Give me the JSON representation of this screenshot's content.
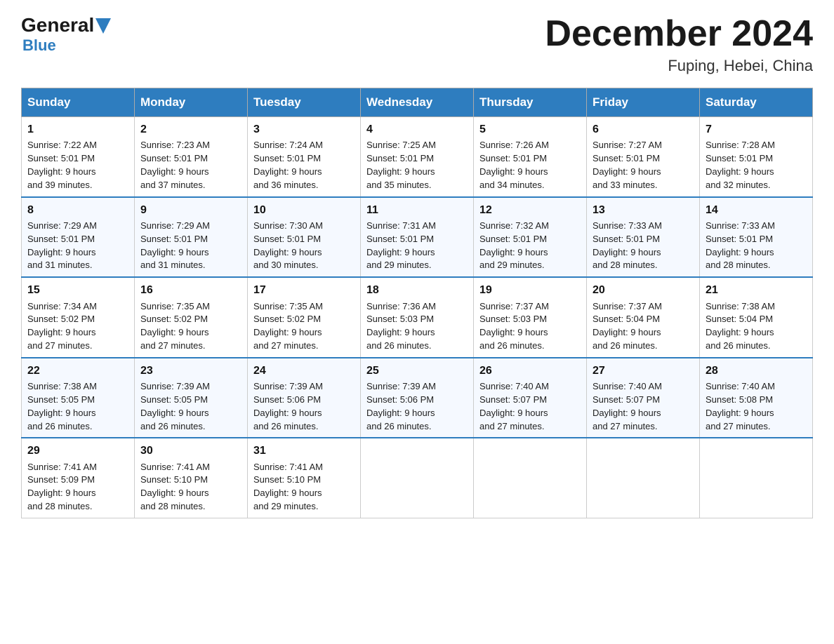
{
  "header": {
    "logo_general": "General",
    "logo_blue": "Blue",
    "month_title": "December 2024",
    "location": "Fuping, Hebei, China"
  },
  "days_of_week": [
    "Sunday",
    "Monday",
    "Tuesday",
    "Wednesday",
    "Thursday",
    "Friday",
    "Saturday"
  ],
  "weeks": [
    [
      {
        "day": "1",
        "sunrise": "7:22 AM",
        "sunset": "5:01 PM",
        "daylight": "9 hours and 39 minutes."
      },
      {
        "day": "2",
        "sunrise": "7:23 AM",
        "sunset": "5:01 PM",
        "daylight": "9 hours and 37 minutes."
      },
      {
        "day": "3",
        "sunrise": "7:24 AM",
        "sunset": "5:01 PM",
        "daylight": "9 hours and 36 minutes."
      },
      {
        "day": "4",
        "sunrise": "7:25 AM",
        "sunset": "5:01 PM",
        "daylight": "9 hours and 35 minutes."
      },
      {
        "day": "5",
        "sunrise": "7:26 AM",
        "sunset": "5:01 PM",
        "daylight": "9 hours and 34 minutes."
      },
      {
        "day": "6",
        "sunrise": "7:27 AM",
        "sunset": "5:01 PM",
        "daylight": "9 hours and 33 minutes."
      },
      {
        "day": "7",
        "sunrise": "7:28 AM",
        "sunset": "5:01 PM",
        "daylight": "9 hours and 32 minutes."
      }
    ],
    [
      {
        "day": "8",
        "sunrise": "7:29 AM",
        "sunset": "5:01 PM",
        "daylight": "9 hours and 31 minutes."
      },
      {
        "day": "9",
        "sunrise": "7:29 AM",
        "sunset": "5:01 PM",
        "daylight": "9 hours and 31 minutes."
      },
      {
        "day": "10",
        "sunrise": "7:30 AM",
        "sunset": "5:01 PM",
        "daylight": "9 hours and 30 minutes."
      },
      {
        "day": "11",
        "sunrise": "7:31 AM",
        "sunset": "5:01 PM",
        "daylight": "9 hours and 29 minutes."
      },
      {
        "day": "12",
        "sunrise": "7:32 AM",
        "sunset": "5:01 PM",
        "daylight": "9 hours and 29 minutes."
      },
      {
        "day": "13",
        "sunrise": "7:33 AM",
        "sunset": "5:01 PM",
        "daylight": "9 hours and 28 minutes."
      },
      {
        "day": "14",
        "sunrise": "7:33 AM",
        "sunset": "5:01 PM",
        "daylight": "9 hours and 28 minutes."
      }
    ],
    [
      {
        "day": "15",
        "sunrise": "7:34 AM",
        "sunset": "5:02 PM",
        "daylight": "9 hours and 27 minutes."
      },
      {
        "day": "16",
        "sunrise": "7:35 AM",
        "sunset": "5:02 PM",
        "daylight": "9 hours and 27 minutes."
      },
      {
        "day": "17",
        "sunrise": "7:35 AM",
        "sunset": "5:02 PM",
        "daylight": "9 hours and 27 minutes."
      },
      {
        "day": "18",
        "sunrise": "7:36 AM",
        "sunset": "5:03 PM",
        "daylight": "9 hours and 26 minutes."
      },
      {
        "day": "19",
        "sunrise": "7:37 AM",
        "sunset": "5:03 PM",
        "daylight": "9 hours and 26 minutes."
      },
      {
        "day": "20",
        "sunrise": "7:37 AM",
        "sunset": "5:04 PM",
        "daylight": "9 hours and 26 minutes."
      },
      {
        "day": "21",
        "sunrise": "7:38 AM",
        "sunset": "5:04 PM",
        "daylight": "9 hours and 26 minutes."
      }
    ],
    [
      {
        "day": "22",
        "sunrise": "7:38 AM",
        "sunset": "5:05 PM",
        "daylight": "9 hours and 26 minutes."
      },
      {
        "day": "23",
        "sunrise": "7:39 AM",
        "sunset": "5:05 PM",
        "daylight": "9 hours and 26 minutes."
      },
      {
        "day": "24",
        "sunrise": "7:39 AM",
        "sunset": "5:06 PM",
        "daylight": "9 hours and 26 minutes."
      },
      {
        "day": "25",
        "sunrise": "7:39 AM",
        "sunset": "5:06 PM",
        "daylight": "9 hours and 26 minutes."
      },
      {
        "day": "26",
        "sunrise": "7:40 AM",
        "sunset": "5:07 PM",
        "daylight": "9 hours and 27 minutes."
      },
      {
        "day": "27",
        "sunrise": "7:40 AM",
        "sunset": "5:07 PM",
        "daylight": "9 hours and 27 minutes."
      },
      {
        "day": "28",
        "sunrise": "7:40 AM",
        "sunset": "5:08 PM",
        "daylight": "9 hours and 27 minutes."
      }
    ],
    [
      {
        "day": "29",
        "sunrise": "7:41 AM",
        "sunset": "5:09 PM",
        "daylight": "9 hours and 28 minutes."
      },
      {
        "day": "30",
        "sunrise": "7:41 AM",
        "sunset": "5:10 PM",
        "daylight": "9 hours and 28 minutes."
      },
      {
        "day": "31",
        "sunrise": "7:41 AM",
        "sunset": "5:10 PM",
        "daylight": "9 hours and 29 minutes."
      },
      null,
      null,
      null,
      null
    ]
  ]
}
